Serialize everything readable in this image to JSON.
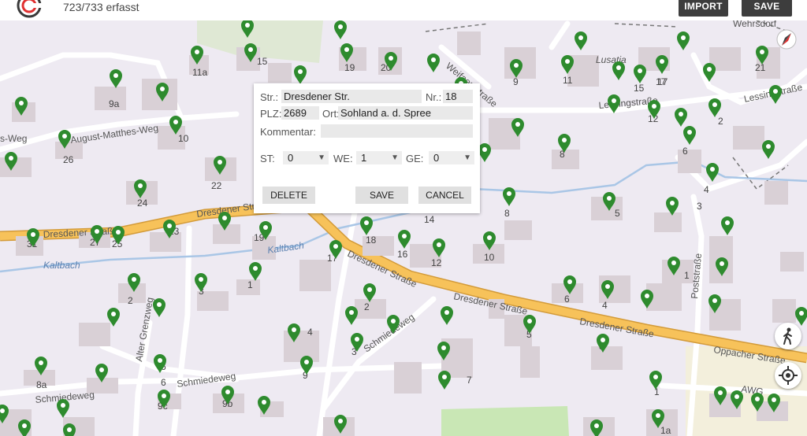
{
  "header": {
    "counter": "723/733 erfasst",
    "import_label": "IMPORT",
    "save_label": "SAVE"
  },
  "colors": {
    "map_bg": "#eeeaf2",
    "building": "#d9d0d6",
    "main_road": "#f7c25a",
    "marker": "#2e8b2e",
    "water": "#a9c6e6"
  },
  "dialog": {
    "street_label": "Str.:",
    "street_value": "Dresdener Str.",
    "nr_label": "Nr.:",
    "nr_value": "18",
    "plz_label": "PLZ:",
    "plz_value": "2689",
    "ort_label": "Ort:",
    "ort_value": "Sohland a. d. Spree",
    "comment_label": "Kommentar:",
    "comment_value": "",
    "st_label": "ST:",
    "st_value": "0",
    "we_label": "WE:",
    "we_value": "1",
    "ge_label": "GE:",
    "ge_value": "0",
    "delete_label": "DELETE",
    "save_label": "SAVE",
    "cancel_label": "CANCEL"
  },
  "map_labels": {
    "streets": [
      "Dresdener Straße",
      "Dresdener Straße",
      "Dresdener Straße",
      "Dresdener Straße",
      "Dresdener Straße",
      "Oppacher Straße",
      "Schmiedeweg",
      "Schmiedeweg",
      "Schmiedeweg",
      "August-Matthes-Weg",
      "Alter Grenzweg",
      "Lessingstraße",
      "Lessingstraße",
      "Weifaer Straße",
      "Poststraße",
      "Lusatia",
      "Wehrsdorf",
      "AWG",
      "Kaltbach",
      "Kaltbach",
      "s-Weg"
    ],
    "house_numbers": [
      "11a",
      "15",
      "19",
      "20",
      "9",
      "11",
      "15",
      "17",
      "19",
      "21",
      "9a",
      "10",
      "26",
      "22",
      "24",
      "27",
      "25",
      "31",
      "23",
      "19",
      "17",
      "18",
      "16",
      "12",
      "10",
      "14",
      "8",
      "5",
      "3",
      "4",
      "1",
      "2",
      "6",
      "4",
      "2",
      "6",
      "3",
      "1",
      "4",
      "5",
      "6",
      "7",
      "8a",
      "9c",
      "9b",
      "9",
      "1",
      "1a",
      "8",
      "8",
      "12",
      "2",
      "6",
      "17",
      "3"
    ]
  }
}
